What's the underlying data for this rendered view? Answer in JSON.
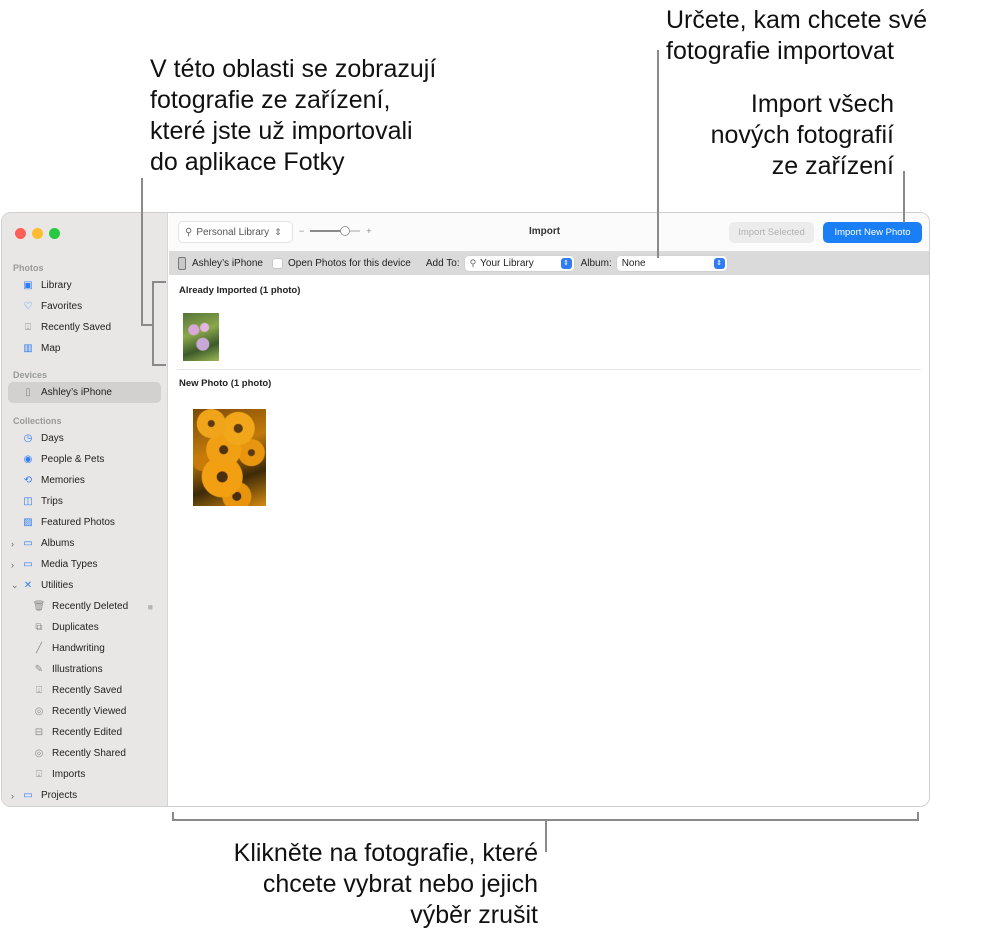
{
  "callouts": {
    "left": [
      "V této oblasti se zobrazují",
      "fotografie ze zařízení,",
      "které jste už importovali",
      "do aplikace Fotky"
    ],
    "top_right": [
      "Určete, kam chcete své",
      "fotografie importovat"
    ],
    "right": [
      "Import všech",
      "nových fotografií",
      "ze zařízení"
    ],
    "bottom": [
      "Klikněte na fotografie, které",
      "chcete vybrat nebo jejich",
      "výběr zrušit"
    ]
  },
  "sidebar": {
    "sections": {
      "photos": "Photos",
      "devices": "Devices",
      "collections": "Collections"
    },
    "photos_items": [
      {
        "label": "Library",
        "icon": "library-icon"
      },
      {
        "label": "Favorites",
        "icon": "heart-icon"
      },
      {
        "label": "Recently Saved",
        "icon": "download-tray-icon"
      },
      {
        "label": "Map",
        "icon": "map-icon"
      }
    ],
    "devices_items": [
      {
        "label": "Ashley’s iPhone",
        "icon": "iphone-icon",
        "selected": true
      }
    ],
    "collections_items": [
      {
        "label": "Days",
        "icon": "clock-icon"
      },
      {
        "label": "People & Pets",
        "icon": "person-circle-icon"
      },
      {
        "label": "Memories",
        "icon": "memories-icon"
      },
      {
        "label": "Trips",
        "icon": "suitcase-icon"
      },
      {
        "label": "Featured Photos",
        "icon": "photo-icon"
      },
      {
        "label": "Albums",
        "icon": "folder-icon",
        "disclosure": "collapsed"
      },
      {
        "label": "Media Types",
        "icon": "folder-icon",
        "disclosure": "collapsed"
      },
      {
        "label": "Utilities",
        "icon": "tools-icon",
        "disclosure": "expanded"
      }
    ],
    "utilities_items": [
      {
        "label": "Recently Deleted",
        "icon": "trash-icon",
        "locked": true
      },
      {
        "label": "Duplicates",
        "icon": "duplicates-icon"
      },
      {
        "label": "Handwriting",
        "icon": "handwriting-icon"
      },
      {
        "label": "Illustrations",
        "icon": "illustrations-icon"
      },
      {
        "label": "Recently Saved",
        "icon": "download-tray-icon"
      },
      {
        "label": "Recently Viewed",
        "icon": "eye-icon"
      },
      {
        "label": "Recently Edited",
        "icon": "edited-icon"
      },
      {
        "label": "Recently Shared",
        "icon": "shared-icon"
      },
      {
        "label": "Imports",
        "icon": "download-tray-icon"
      }
    ],
    "projects": {
      "label": "Projects",
      "icon": "folder-icon",
      "disclosure": "collapsed"
    }
  },
  "toolbar": {
    "library_select": "Personal Library",
    "zoom_minus": "−",
    "zoom_plus": "+",
    "zoom_level": 0.7,
    "title": "Import",
    "import_selected": "Import Selected",
    "import_new": "Import New Photo"
  },
  "device_bar": {
    "device_name": "Ashley’s iPhone",
    "open_photos_label": "Open Photos for this device",
    "open_photos_checked": false,
    "add_to_label": "Add To:",
    "add_to_value": "Your Library",
    "album_label": "Album:",
    "album_value": "None"
  },
  "content": {
    "already_imported": "Already Imported (1 photo)",
    "new_photo": "New Photo (1 photo)"
  },
  "colors": {
    "accent": "#1a7ff5",
    "sidebar_bg": "#e8e7e6",
    "traffic_red": "#fe5f57",
    "traffic_yellow": "#febc2e",
    "traffic_green": "#28c840"
  }
}
